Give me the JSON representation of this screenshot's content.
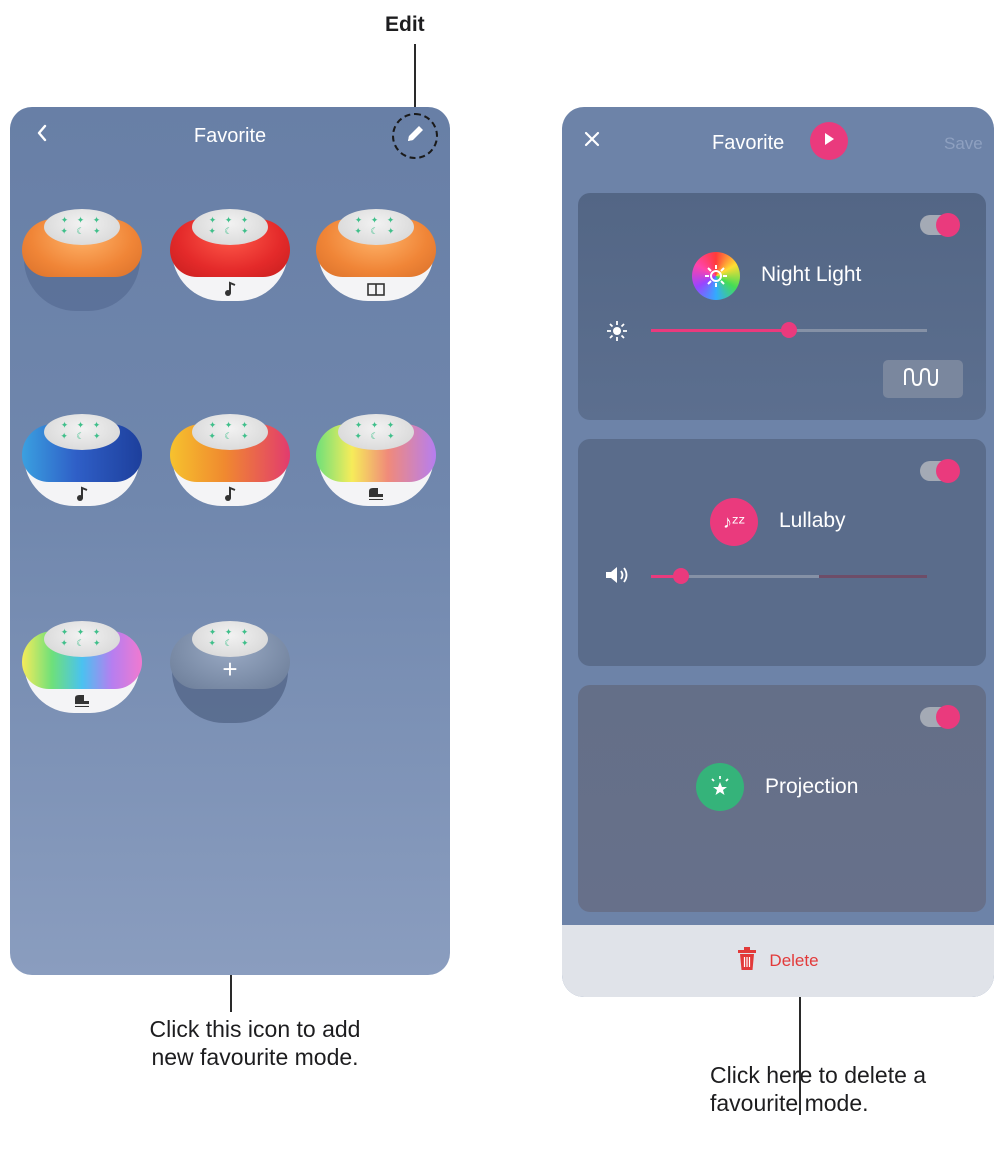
{
  "callouts": {
    "edit": "Edit",
    "add_line1": "Click this icon to add",
    "add_line2": "new favourite mode.",
    "delete_line1": "Click here to delete a",
    "delete_line2": "favourite mode."
  },
  "left_screen": {
    "title": "Favorite",
    "back_icon": "chevron-left-icon",
    "edit_icon": "pencil-icon",
    "add_symbol": "+",
    "devices": [
      {
        "mode_icon": "none",
        "body_color": "#f0883a"
      },
      {
        "mode_icon": "music-note-icon",
        "body_color": "#e42f2f"
      },
      {
        "mode_icon": "book-icon",
        "body_color": "#f0883a"
      },
      {
        "mode_icon": "music-note-icon",
        "body_color": "multicolor"
      },
      {
        "mode_icon": "music-note-icon",
        "body_color": "multicolor"
      },
      {
        "mode_icon": "piano-icon",
        "body_color": "rainbow"
      },
      {
        "mode_icon": "piano-icon",
        "body_color": "rainbow"
      },
      {
        "mode_icon": "add-icon",
        "body_color": "#7d8ea9"
      }
    ]
  },
  "right_screen": {
    "close_symbol": "✕",
    "title": "Favorite",
    "save_label": "Save",
    "night_light": {
      "label": "Night Light",
      "enabled": true,
      "brightness": 0.5
    },
    "lullaby": {
      "label": "Lullaby",
      "enabled": true,
      "volume": 0.11,
      "icon_text": "♪ᶻᶻ"
    },
    "projection": {
      "label": "Projection",
      "enabled": true
    },
    "delete_label": "Delete"
  },
  "colors": {
    "accent": "#ea3a7d",
    "delete": "#e23a3a",
    "projection_green": "#35b37a",
    "screen_bg": "#6d83a8"
  }
}
